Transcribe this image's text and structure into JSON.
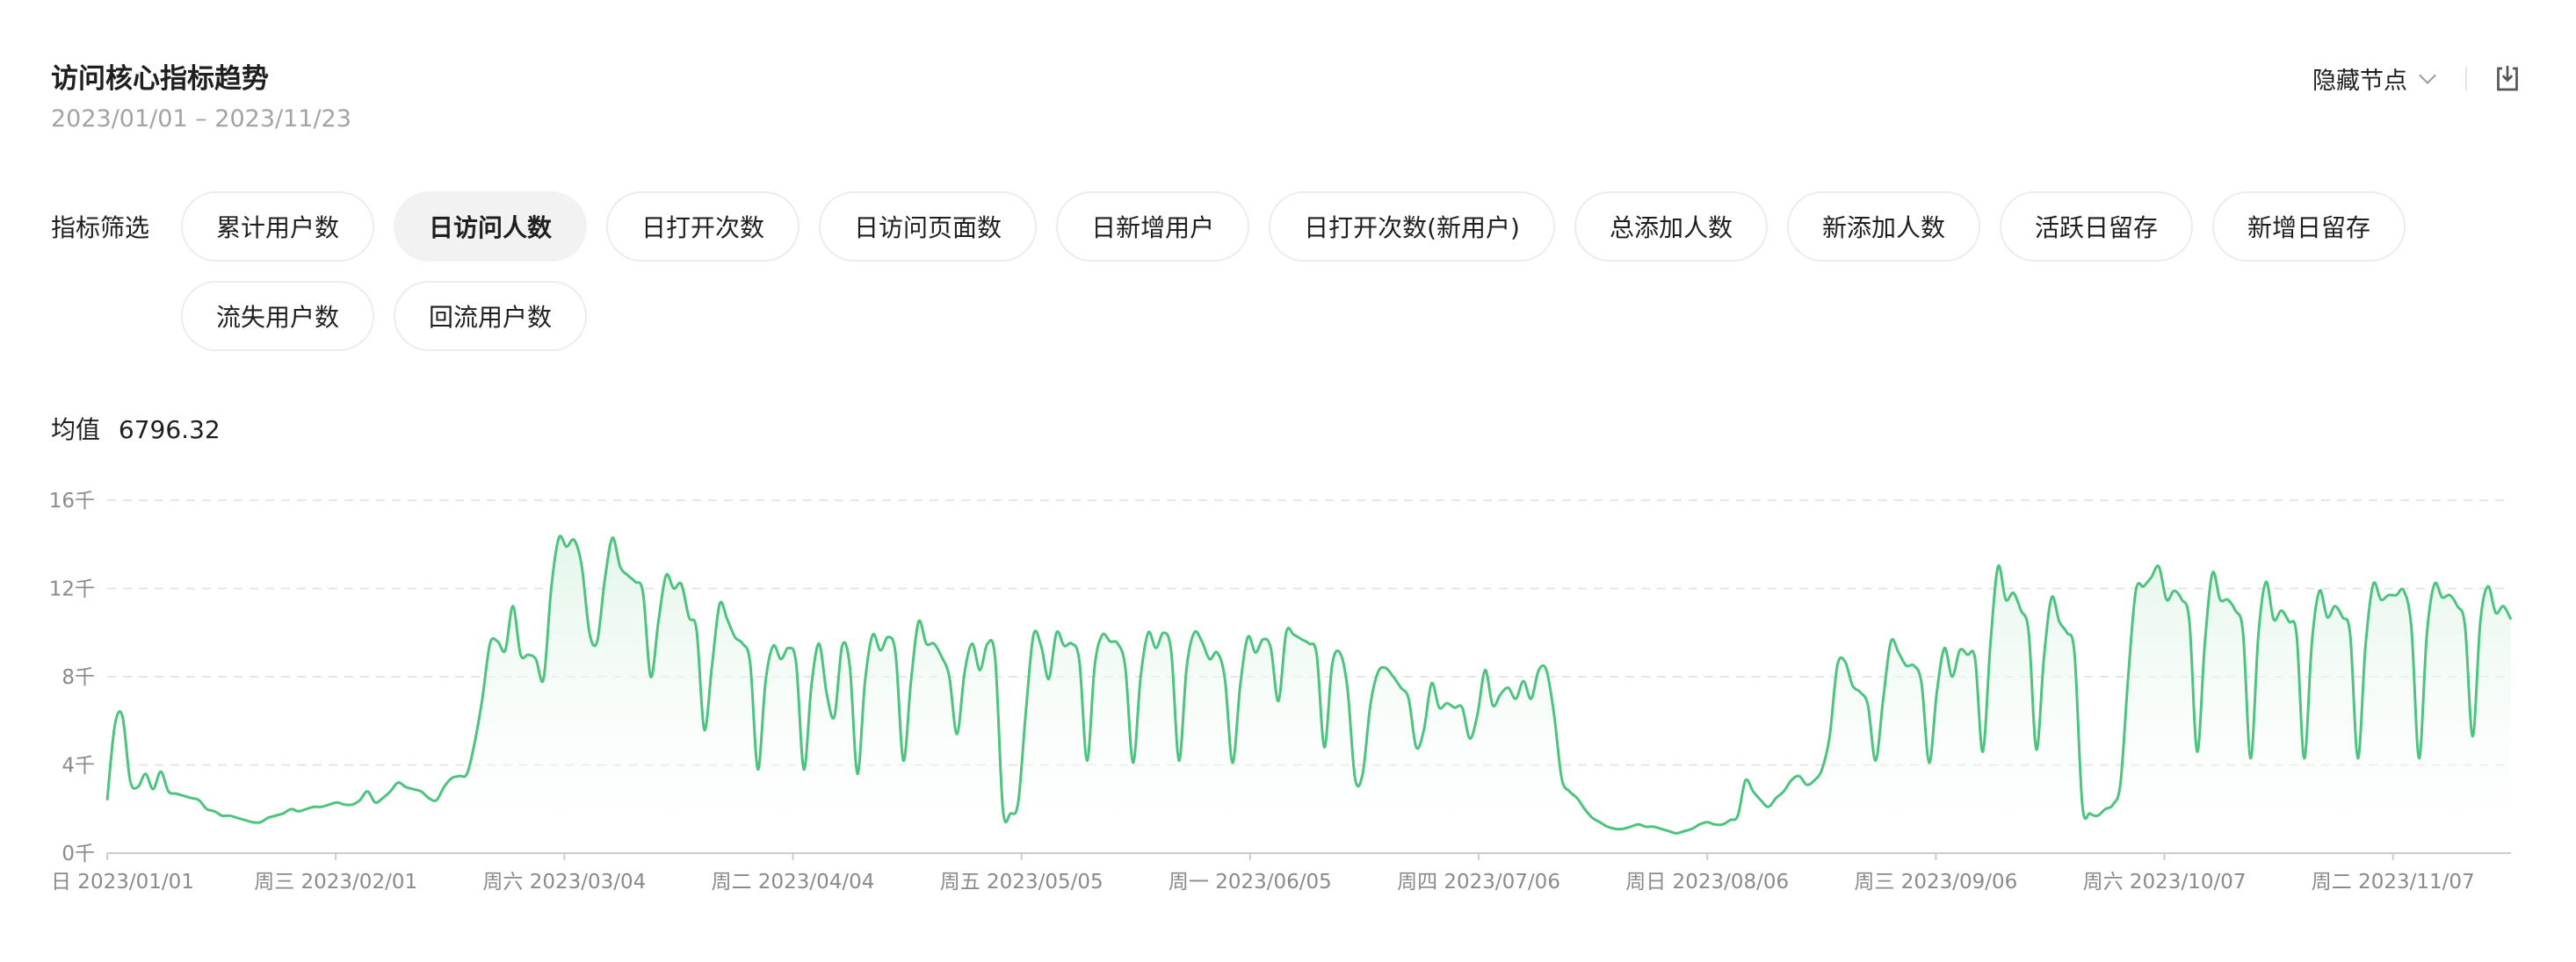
{
  "header": {
    "title": "访问核心指标趋势",
    "date_range": "2023/01/01 – 2023/11/23",
    "hide_nodes_label": "隐藏节点",
    "download_icon": "download-icon"
  },
  "filters": {
    "label": "指标筛选",
    "items": [
      "累计用户数",
      "日访问人数",
      "日打开次数",
      "日访问页面数",
      "日新增用户",
      "日打开次数(新用户)",
      "总添加人数",
      "新添加人数",
      "活跃日留存",
      "新增日留存",
      "流失用户数",
      "回流用户数"
    ],
    "active": "日访问人数"
  },
  "summary": {
    "mean_label": "均值",
    "mean_value": "6796.32"
  },
  "colors": {
    "line": "#4cc47e",
    "area_top": "#e3f6ea",
    "grid": "#e6e6e6",
    "axis": "#cccccc"
  },
  "chart_data": {
    "type": "area",
    "ylim": [
      0,
      16000
    ],
    "y_ticks": [
      0,
      4000,
      8000,
      12000,
      16000
    ],
    "y_tick_labels": [
      "0千",
      "4千",
      "8千",
      "12千",
      "16千"
    ],
    "x_start": "2023/01/01",
    "x_end": "2023/11/23",
    "x_ticks": [
      "2023/01/01",
      "2023/02/01",
      "2023/03/04",
      "2023/04/04",
      "2023/05/05",
      "2023/06/05",
      "2023/07/06",
      "2023/08/06",
      "2023/09/06",
      "2023/10/07",
      "2023/11/07"
    ],
    "x_tick_labels": [
      "日 2023/01/01",
      "周三 2023/02/01",
      "周六 2023/03/04",
      "周二 2023/04/04",
      "周五 2023/05/05",
      "周一 2023/06/05",
      "周四 2023/07/06",
      "周日 2023/08/06",
      "周三 2023/09/06",
      "周六 2023/10/07",
      "周二 2023/11/07"
    ],
    "grid": true,
    "series": [
      {
        "values": [
          2400,
          5800,
          6200,
          3300,
          3000,
          3600,
          2900,
          3700,
          2800,
          2700,
          2600,
          2500,
          2400,
          2000,
          1900,
          1700,
          1700,
          1600,
          1500,
          1400,
          1400,
          1600,
          1700,
          1800,
          2000,
          1900,
          2000,
          2100,
          2100,
          2200,
          2300,
          2200,
          2200,
          2400,
          2800,
          2300,
          2500,
          2800,
          3200,
          3000,
          2900,
          2800,
          2500,
          2400,
          3000,
          3400,
          3500,
          3600,
          5000,
          7000,
          9500,
          9600,
          9200,
          11200,
          9000,
          9000,
          8800,
          7900,
          12000,
          14300,
          13900,
          14200,
          13000,
          10000,
          9600,
          12400,
          14300,
          13000,
          12600,
          12300,
          11800,
          8000,
          10500,
          12600,
          12000,
          12200,
          10700,
          10100,
          5600,
          8500,
          11300,
          10600,
          9800,
          9500,
          8600,
          3800,
          7800,
          9400,
          8800,
          9300,
          8600,
          3800,
          7600,
          9500,
          7200,
          6200,
          9400,
          8500,
          3600,
          7800,
          9900,
          9200,
          9800,
          9000,
          4200,
          7800,
          10500,
          9500,
          9500,
          8900,
          8000,
          5400,
          8200,
          9500,
          8300,
          9500,
          8800,
          2000,
          1800,
          2300,
          6400,
          9900,
          9400,
          7900,
          10000,
          9400,
          9500,
          8700,
          4200,
          8500,
          9900,
          9600,
          9500,
          8400,
          4100,
          8000,
          10000,
          9300,
          10000,
          9100,
          4200,
          8400,
          10000,
          9600,
          8800,
          9100,
          7900,
          4100,
          7600,
          9800,
          9100,
          9700,
          9300,
          6900,
          10000,
          9900,
          9700,
          9500,
          9000,
          4800,
          8500,
          9100,
          7500,
          3400,
          3600,
          6700,
          8200,
          8400,
          8000,
          7500,
          7000,
          4800,
          5600,
          7700,
          6600,
          6800,
          6600,
          6600,
          5200,
          6300,
          8300,
          6700,
          7200,
          7500,
          7000,
          7800,
          7000,
          8300,
          8300,
          6300,
          3400,
          2800,
          2500,
          2000,
          1600,
          1400,
          1200,
          1100,
          1100,
          1200,
          1300,
          1200,
          1200,
          1100,
          1000,
          900,
          1000,
          1100,
          1300,
          1400,
          1300,
          1300,
          1500,
          1700,
          3300,
          2800,
          2400,
          2100,
          2500,
          2800,
          3300,
          3500,
          3100,
          3300,
          3800,
          5300,
          8500,
          8700,
          7600,
          7300,
          6700,
          4200,
          7000,
          9600,
          9100,
          8500,
          8500,
          7700,
          4100,
          7300,
          9300,
          8000,
          9200,
          9000,
          8800,
          4600,
          9500,
          13000,
          11500,
          11800,
          11000,
          10000,
          4700,
          8900,
          11600,
          10500,
          10000,
          9000,
          2200,
          1800,
          1700,
          2000,
          2200,
          3200,
          8000,
          11900,
          12100,
          12500,
          13000,
          11500,
          11900,
          11500,
          10500,
          4600,
          9500,
          12700,
          11500,
          11500,
          11000,
          10000,
          4300,
          9900,
          12300,
          10600,
          11000,
          10500,
          9900,
          4300,
          9600,
          11900,
          10700,
          11200,
          10700,
          9900,
          4300,
          9400,
          12200,
          11500,
          11700,
          11700,
          11900,
          10200,
          4300,
          9900,
          12200,
          11600,
          11700,
          11200,
          10300,
          5300,
          10500,
          12100,
          10900,
          11200,
          10600
        ]
      }
    ]
  }
}
